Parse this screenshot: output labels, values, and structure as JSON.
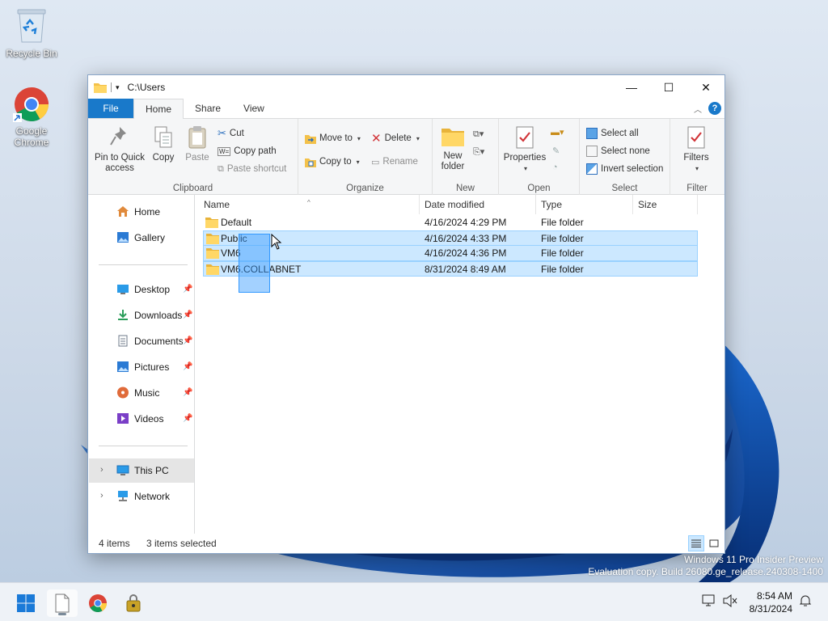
{
  "desktop": {
    "icons": [
      {
        "label": "Recycle Bin",
        "icon": "recycle-bin-icon"
      },
      {
        "label": "Google Chrome",
        "icon": "chrome-icon"
      }
    ],
    "watermark_line1": "Windows 11 Pro Insider Preview",
    "watermark_line2": "Evaluation copy. Build 26080.ge_release.240308-1400"
  },
  "window": {
    "title": "C:\\Users",
    "controls": {
      "minimize": "—",
      "maximize": "☐",
      "close": "✕"
    },
    "tabs": [
      "File",
      "Home",
      "Share",
      "View"
    ],
    "active_tab": "Home",
    "ribbon": {
      "clipboard": {
        "label": "Clipboard",
        "pin_to_quick_access": "Pin to Quick access",
        "copy": "Copy",
        "paste": "Paste",
        "cut": "Cut",
        "copy_path": "Copy path",
        "paste_shortcut": "Paste shortcut"
      },
      "organize": {
        "label": "Organize",
        "move_to": "Move to",
        "copy_to": "Copy to",
        "delete": "Delete",
        "rename": "Rename"
      },
      "new": {
        "label": "New",
        "new_folder": "New folder"
      },
      "open": {
        "label": "Open",
        "properties": "Properties"
      },
      "select": {
        "label": "Select",
        "select_all": "Select all",
        "select_none": "Select none",
        "invert_selection": "Invert selection"
      },
      "filter": {
        "label": "Filter",
        "filters": "Filters"
      }
    },
    "nav": {
      "items": [
        {
          "label": "Home",
          "icon": "home-icon",
          "pinned": false
        },
        {
          "label": "Gallery",
          "icon": "gallery-icon",
          "pinned": false
        },
        {
          "label": "Desktop",
          "icon": "desktop-icon",
          "pinned": true
        },
        {
          "label": "Downloads",
          "icon": "downloads-icon",
          "pinned": true
        },
        {
          "label": "Documents",
          "icon": "documents-icon",
          "pinned": true
        },
        {
          "label": "Pictures",
          "icon": "pictures-icon",
          "pinned": true
        },
        {
          "label": "Music",
          "icon": "music-icon",
          "pinned": true
        },
        {
          "label": "Videos",
          "icon": "videos-icon",
          "pinned": true
        },
        {
          "label": "This PC",
          "icon": "this-pc-icon",
          "expandable": true,
          "selected": true
        },
        {
          "label": "Network",
          "icon": "network-icon",
          "expandable": true
        }
      ]
    },
    "list": {
      "columns": [
        "Name",
        "Date modified",
        "Type",
        "Size"
      ],
      "rows": [
        {
          "name": "Default",
          "date": "4/16/2024 4:29 PM",
          "type": "File folder",
          "size": "",
          "selected": false
        },
        {
          "name": "Public",
          "date": "4/16/2024 4:33 PM",
          "type": "File folder",
          "size": "",
          "selected": true
        },
        {
          "name": "VM6",
          "date": "4/16/2024 4:36 PM",
          "type": "File folder",
          "size": "",
          "selected": true
        },
        {
          "name": "VM6.COLLABNET",
          "date": "8/31/2024 8:49 AM",
          "type": "File folder",
          "size": "",
          "selected": true
        }
      ]
    },
    "status": {
      "item_count": "4 items",
      "selected_count": "3 items selected"
    }
  },
  "taskbar": {
    "apps": [
      "start-icon",
      "notepad-icon",
      "chrome-icon",
      "security-lock-icon"
    ],
    "time": "8:54 AM",
    "date": "8/31/2024"
  },
  "colors": {
    "accent": "#1979ca",
    "selection": "#cce8ff",
    "selection_border": "#99d1ff"
  }
}
